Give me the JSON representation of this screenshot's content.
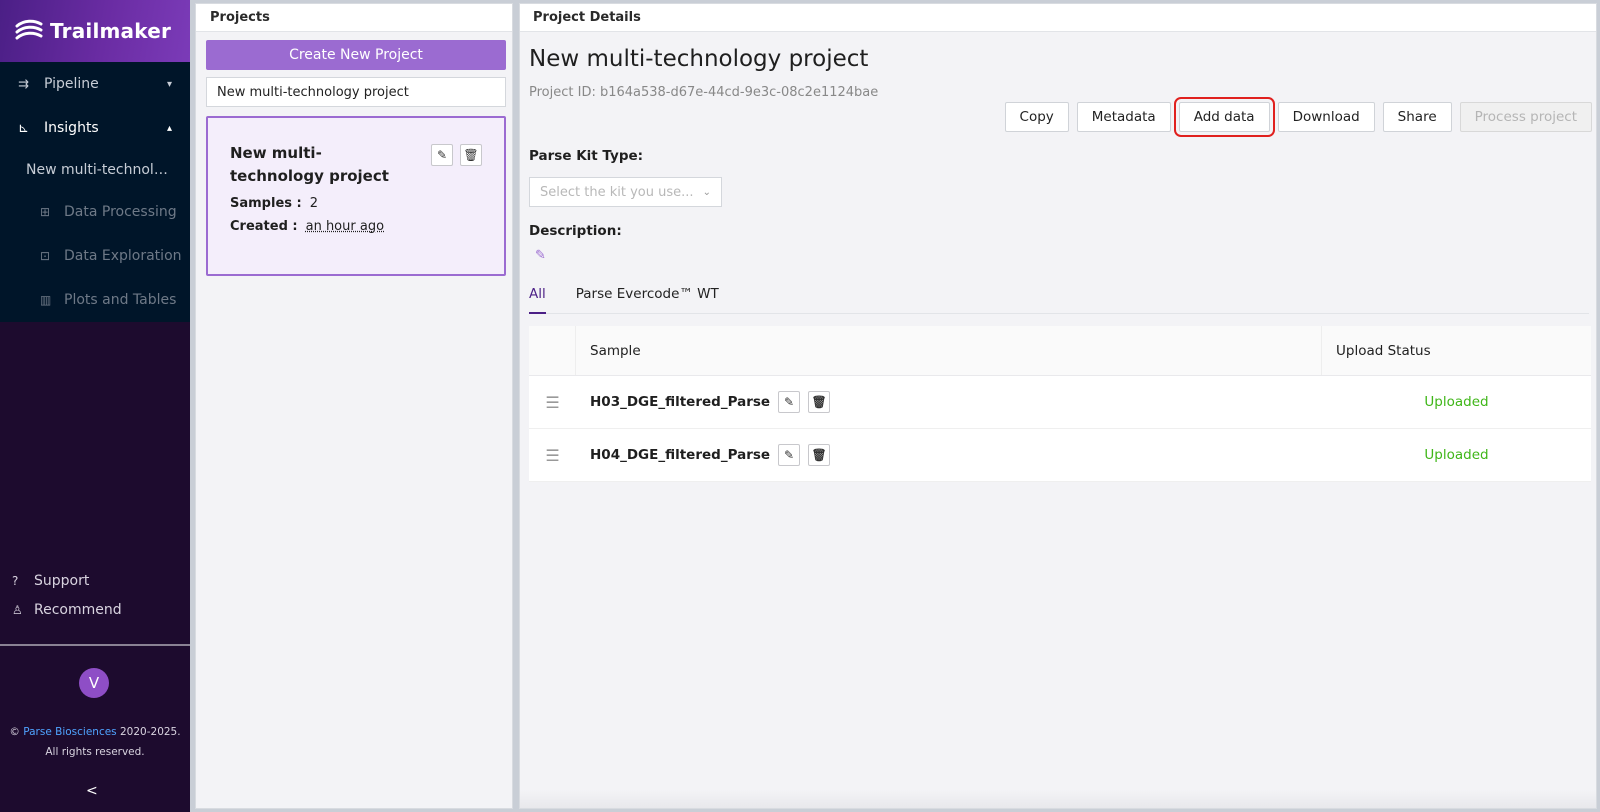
{
  "app": {
    "name": "Trailmaker"
  },
  "sidebar": {
    "items": [
      {
        "label": "Pipeline",
        "icon": "pipeline-icon"
      },
      {
        "label": "Insights",
        "icon": "insights-icon"
      }
    ],
    "current_project": "New multi-technology project",
    "sub_items": [
      {
        "label": "Data Processing",
        "icon": "data-processing-icon"
      },
      {
        "label": "Data Exploration",
        "icon": "data-exploration-icon"
      },
      {
        "label": "Plots and Tables",
        "icon": "plots-icon"
      }
    ],
    "bottom": [
      {
        "label": "Support",
        "icon": "question-circle-icon"
      },
      {
        "label": "Recommend",
        "icon": "user-add-icon"
      }
    ],
    "avatar_initial": "V",
    "copyright_prefix": "©",
    "copyright_link": "Parse Biosciences",
    "copyright_years": "2020-2025.",
    "copyright_line2": "All rights reserved."
  },
  "projects_panel": {
    "title": "Projects",
    "create_label": "Create New Project",
    "search_value": "New multi-technology project",
    "card": {
      "title": "New multi-technology project",
      "samples_label": "Samples :",
      "samples_value": "2",
      "created_label": "Created :",
      "created_value": "an hour ago"
    }
  },
  "details": {
    "panel_title": "Project Details",
    "project_name": "New multi-technology project",
    "project_id": "Project ID: b164a538-d67e-44cd-9e3c-08c2e1124bae",
    "buttons": {
      "copy": "Copy",
      "metadata": "Metadata",
      "add_data": "Add data",
      "download": "Download",
      "share": "Share",
      "process": "Process project"
    },
    "kit_label": "Parse Kit Type:",
    "kit_placeholder": "Select the kit you use...",
    "description_label": "Description:",
    "tabs": [
      "All",
      "Parse Evercode™ WT"
    ],
    "table": {
      "col_sample": "Sample",
      "col_status": "Upload Status",
      "rows": [
        {
          "sample": "H03_DGE_filtered_Parse",
          "status": "Uploaded"
        },
        {
          "sample": "H04_DGE_filtered_Parse",
          "status": "Uploaded"
        }
      ]
    }
  },
  "colors": {
    "brand_purple": "#9b6bd1",
    "sidebar_bg": "#001529",
    "uploaded_green": "#3fb618",
    "highlight_red": "#e0201e"
  }
}
